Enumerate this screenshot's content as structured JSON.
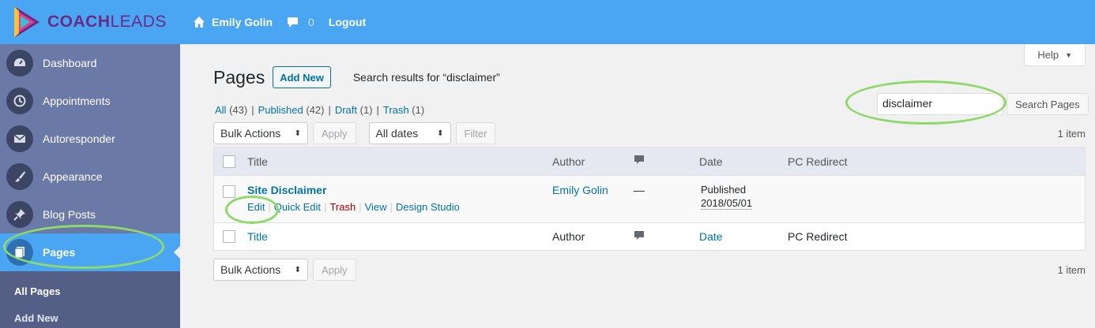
{
  "brand": {
    "name_bold": "COACH",
    "name_light": "LEADS"
  },
  "topbar": {
    "user": "Emily Golin",
    "comments_count": "0",
    "logout": "Logout"
  },
  "sidebar": {
    "items": [
      {
        "label": "Dashboard",
        "icon": "dashboard-icon"
      },
      {
        "label": "Appointments",
        "icon": "history-icon"
      },
      {
        "label": "Autoresponder",
        "icon": "mail-icon"
      },
      {
        "label": "Appearance",
        "icon": "brush-icon"
      },
      {
        "label": "Blog Posts",
        "icon": "pin-icon"
      },
      {
        "label": "Pages",
        "icon": "pages-icon"
      }
    ],
    "submenu": [
      "All Pages",
      "Add New"
    ]
  },
  "header": {
    "title": "Pages",
    "add_new": "Add New",
    "search_results": "Search results for “disclaimer”",
    "help": "Help"
  },
  "filters": {
    "all": "All",
    "all_count": "(43)",
    "published": "Published",
    "published_count": "(42)",
    "draft": "Draft",
    "draft_count": "(1)",
    "trash": "Trash",
    "trash_count": "(1)"
  },
  "search": {
    "value": "disclaimer",
    "button": "Search Pages"
  },
  "toolbar": {
    "bulk_actions": "Bulk Actions",
    "apply": "Apply",
    "dates": "All dates",
    "filter": "Filter",
    "items": "1 item"
  },
  "table": {
    "columns": {
      "title": "Title",
      "author": "Author",
      "date": "Date",
      "pc_redirect": "PC Redirect"
    },
    "rows": [
      {
        "title": "Site Disclaimer",
        "actions": {
          "edit": "Edit",
          "quick_edit": "Quick Edit",
          "trash": "Trash",
          "view": "View",
          "design_studio": "Design Studio"
        },
        "author": "Emily Golin",
        "comments": "—",
        "status": "Published",
        "date": "2018/05/01"
      }
    ]
  },
  "colors": {
    "topbar": "#4aa6f2",
    "sidebar": "#6a79a6",
    "highlight": "#8dd96a",
    "link": "#0073aa"
  }
}
